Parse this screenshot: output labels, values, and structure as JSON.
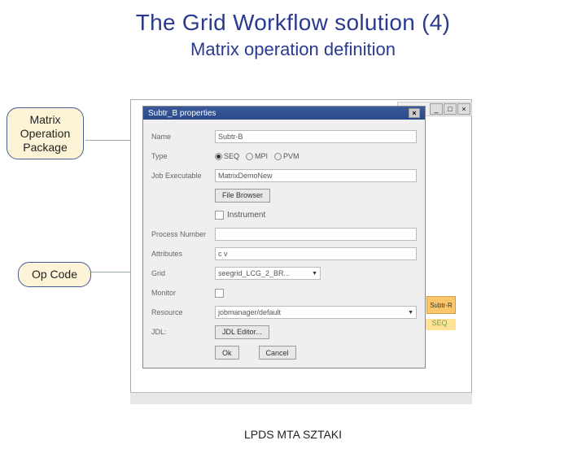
{
  "slide": {
    "title": "The Grid Workflow solution (4)",
    "subtitle": "Matrix operation definition",
    "footer": "LPDS MTA SZTAKI"
  },
  "callouts": {
    "matrix_op_pkg": "Matrix\nOperation\nPackage",
    "op_code": "Op Code"
  },
  "bg_window": {
    "node_label": "Subtr-R",
    "type_label": "SEQ",
    "min": "_",
    "max": "□",
    "close": "×"
  },
  "dialog": {
    "title": "Subtr_B properties",
    "close": "×",
    "labels": {
      "name": "Name",
      "type": "Type",
      "job_exec": "Job Executable",
      "file_browser_btn": "File Browser",
      "instrument": "Instrument",
      "proc_num": "Process Number",
      "attributes": "Attributes",
      "grid": "Grid",
      "monitor": "Monitor",
      "resource": "Resource",
      "jdl": "JDL:",
      "jdl_editor_btn": "JDL Editor...",
      "ok_btn": "Ok",
      "cancel_btn": "Cancel"
    },
    "values": {
      "name": "Subtr-B",
      "job_exec": "MatrixDemoNew",
      "attributes": "c v",
      "grid": "seegrid_LCG_2_BR...",
      "resource": "jobmanager/default"
    },
    "types": {
      "seq": "SEQ",
      "mpi": "MPI",
      "pvm": "PVM"
    }
  }
}
